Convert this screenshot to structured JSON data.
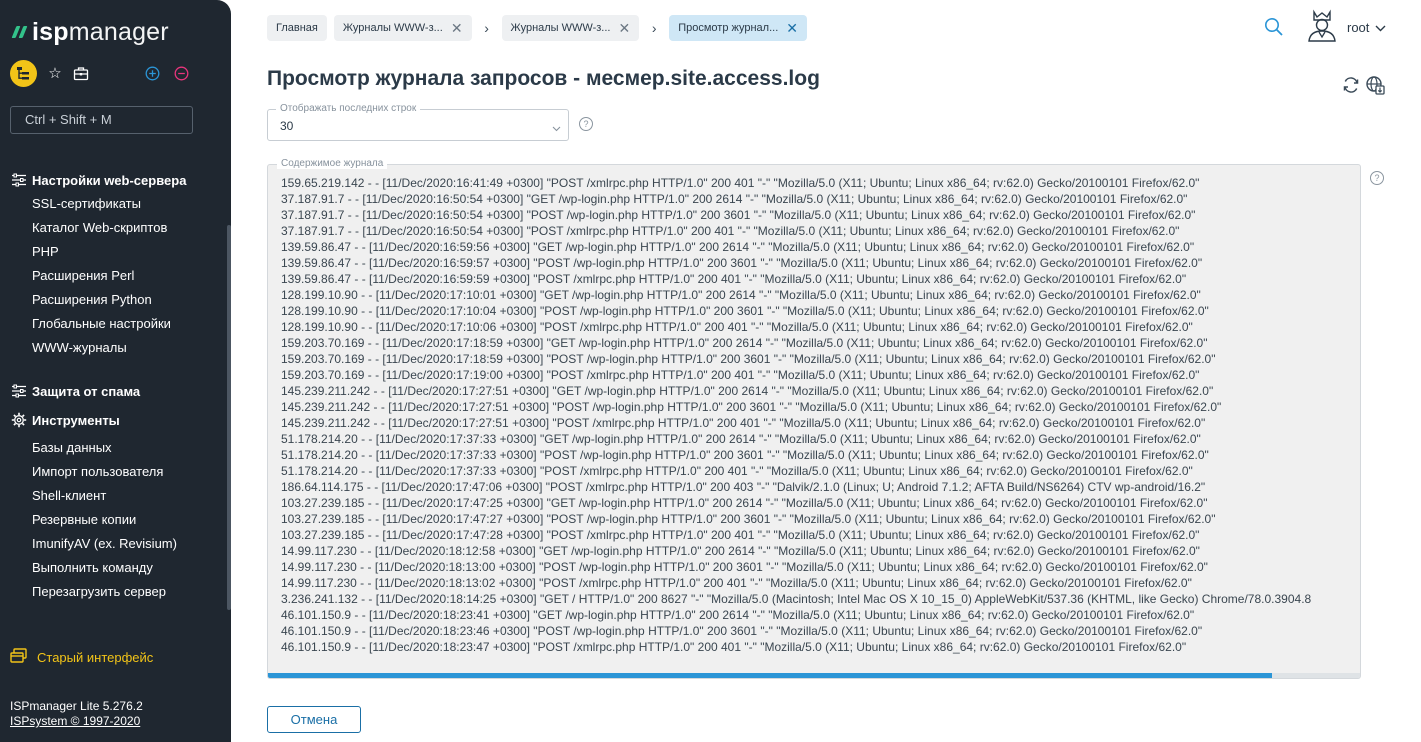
{
  "logo": {
    "part1": "isp",
    "part2": "manager"
  },
  "sidebar": {
    "search_placeholder": "Ctrl + Shift + M",
    "groups": [
      {
        "label": "Настройки web-сервера",
        "icon": "sliders-icon",
        "items": [
          "SSL-сертификаты",
          "Каталог Web-скриптов",
          "PHP",
          "Расширения Perl",
          "Расширения Python",
          "Глобальные настройки",
          "WWW-журналы"
        ]
      },
      {
        "label": "Защита от спама",
        "icon": "sliders-icon",
        "items": []
      },
      {
        "label": "Инструменты",
        "icon": "gear-icon",
        "items": [
          "Базы данных",
          "Импорт пользователя",
          "Shell-клиент",
          "Резервные копии",
          "ImunifyAV (ex. Revisium)",
          "Выполнить команду",
          "Перезагрузить сервер"
        ]
      }
    ],
    "old_interface": "Старый интерфейс",
    "version": "ISPmanager Lite 5.276.2",
    "copyright": "ISPsystem © 1997-2020"
  },
  "breadcrumbs": [
    "Главная",
    "Журналы WWW-з...",
    "Журналы WWW-з...",
    "Просмотр журнал..."
  ],
  "user": {
    "name": "root"
  },
  "page": {
    "title": "Просмотр журнала запросов - месмеp.site.access.log",
    "lines_field": {
      "label": "Отображать последних строк",
      "value": "30"
    },
    "log_label": "Содержимое журнала",
    "help_symbol": "?",
    "cancel": "Отмена",
    "log_lines": [
      "159.65.219.142 - - [11/Dec/2020:16:41:49 +0300] \"POST /xmlrpc.php HTTP/1.0\" 200 401 \"-\" \"Mozilla/5.0 (X11; Ubuntu; Linux x86_64; rv:62.0) Gecko/20100101 Firefox/62.0\"",
      "37.187.91.7 - - [11/Dec/2020:16:50:54 +0300] \"GET /wp-login.php HTTP/1.0\" 200 2614 \"-\" \"Mozilla/5.0 (X11; Ubuntu; Linux x86_64; rv:62.0) Gecko/20100101 Firefox/62.0\"",
      "37.187.91.7 - - [11/Dec/2020:16:50:54 +0300] \"POST /wp-login.php HTTP/1.0\" 200 3601 \"-\" \"Mozilla/5.0 (X11; Ubuntu; Linux x86_64; rv:62.0) Gecko/20100101 Firefox/62.0\"",
      "37.187.91.7 - - [11/Dec/2020:16:50:54 +0300] \"POST /xmlrpc.php HTTP/1.0\" 200 401 \"-\" \"Mozilla/5.0 (X11; Ubuntu; Linux x86_64; rv:62.0) Gecko/20100101 Firefox/62.0\"",
      "139.59.86.47 - - [11/Dec/2020:16:59:56 +0300] \"GET /wp-login.php HTTP/1.0\" 200 2614 \"-\" \"Mozilla/5.0 (X11; Ubuntu; Linux x86_64; rv:62.0) Gecko/20100101 Firefox/62.0\"",
      "139.59.86.47 - - [11/Dec/2020:16:59:57 +0300] \"POST /wp-login.php HTTP/1.0\" 200 3601 \"-\" \"Mozilla/5.0 (X11; Ubuntu; Linux x86_64; rv:62.0) Gecko/20100101 Firefox/62.0\"",
      "139.59.86.47 - - [11/Dec/2020:16:59:59 +0300] \"POST /xmlrpc.php HTTP/1.0\" 200 401 \"-\" \"Mozilla/5.0 (X11; Ubuntu; Linux x86_64; rv:62.0) Gecko/20100101 Firefox/62.0\"",
      "128.199.10.90 - - [11/Dec/2020:17:10:01 +0300] \"GET /wp-login.php HTTP/1.0\" 200 2614 \"-\" \"Mozilla/5.0 (X11; Ubuntu; Linux x86_64; rv:62.0) Gecko/20100101 Firefox/62.0\"",
      "128.199.10.90 - - [11/Dec/2020:17:10:04 +0300] \"POST /wp-login.php HTTP/1.0\" 200 3601 \"-\" \"Mozilla/5.0 (X11; Ubuntu; Linux x86_64; rv:62.0) Gecko/20100101 Firefox/62.0\"",
      "128.199.10.90 - - [11/Dec/2020:17:10:06 +0300] \"POST /xmlrpc.php HTTP/1.0\" 200 401 \"-\" \"Mozilla/5.0 (X11; Ubuntu; Linux x86_64; rv:62.0) Gecko/20100101 Firefox/62.0\"",
      "159.203.70.169 - - [11/Dec/2020:17:18:59 +0300] \"GET /wp-login.php HTTP/1.0\" 200 2614 \"-\" \"Mozilla/5.0 (X11; Ubuntu; Linux x86_64; rv:62.0) Gecko/20100101 Firefox/62.0\"",
      "159.203.70.169 - - [11/Dec/2020:17:18:59 +0300] \"POST /wp-login.php HTTP/1.0\" 200 3601 \"-\" \"Mozilla/5.0 (X11; Ubuntu; Linux x86_64; rv:62.0) Gecko/20100101 Firefox/62.0\"",
      "159.203.70.169 - - [11/Dec/2020:17:19:00 +0300] \"POST /xmlrpc.php HTTP/1.0\" 200 401 \"-\" \"Mozilla/5.0 (X11; Ubuntu; Linux x86_64; rv:62.0) Gecko/20100101 Firefox/62.0\"",
      "145.239.211.242 - - [11/Dec/2020:17:27:51 +0300] \"GET /wp-login.php HTTP/1.0\" 200 2614 \"-\" \"Mozilla/5.0 (X11; Ubuntu; Linux x86_64; rv:62.0) Gecko/20100101 Firefox/62.0\"",
      "145.239.211.242 - - [11/Dec/2020:17:27:51 +0300] \"POST /wp-login.php HTTP/1.0\" 200 3601 \"-\" \"Mozilla/5.0 (X11; Ubuntu; Linux x86_64; rv:62.0) Gecko/20100101 Firefox/62.0\"",
      "145.239.211.242 - - [11/Dec/2020:17:27:51 +0300] \"POST /xmlrpc.php HTTP/1.0\" 200 401 \"-\" \"Mozilla/5.0 (X11; Ubuntu; Linux x86_64; rv:62.0) Gecko/20100101 Firefox/62.0\"",
      "51.178.214.20 - - [11/Dec/2020:17:37:33 +0300] \"GET /wp-login.php HTTP/1.0\" 200 2614 \"-\" \"Mozilla/5.0 (X11; Ubuntu; Linux x86_64; rv:62.0) Gecko/20100101 Firefox/62.0\"",
      "51.178.214.20 - - [11/Dec/2020:17:37:33 +0300] \"POST /wp-login.php HTTP/1.0\" 200 3601 \"-\" \"Mozilla/5.0 (X11; Ubuntu; Linux x86_64; rv:62.0) Gecko/20100101 Firefox/62.0\"",
      "51.178.214.20 - - [11/Dec/2020:17:37:33 +0300] \"POST /xmlrpc.php HTTP/1.0\" 200 401 \"-\" \"Mozilla/5.0 (X11; Ubuntu; Linux x86_64; rv:62.0) Gecko/20100101 Firefox/62.0\"",
      "186.64.114.175 - - [11/Dec/2020:17:47:06 +0300] \"POST /xmlrpc.php HTTP/1.0\" 200 403 \"-\" \"Dalvik/2.1.0 (Linux; U; Android 7.1.2; AFTA Build/NS6264) CTV wp-android/16.2\"",
      "103.27.239.185 - - [11/Dec/2020:17:47:25 +0300] \"GET /wp-login.php HTTP/1.0\" 200 2614 \"-\" \"Mozilla/5.0 (X11; Ubuntu; Linux x86_64; rv:62.0) Gecko/20100101 Firefox/62.0\"",
      "103.27.239.185 - - [11/Dec/2020:17:47:27 +0300] \"POST /wp-login.php HTTP/1.0\" 200 3601 \"-\" \"Mozilla/5.0 (X11; Ubuntu; Linux x86_64; rv:62.0) Gecko/20100101 Firefox/62.0\"",
      "103.27.239.185 - - [11/Dec/2020:17:47:28 +0300] \"POST /xmlrpc.php HTTP/1.0\" 200 401 \"-\" \"Mozilla/5.0 (X11; Ubuntu; Linux x86_64; rv:62.0) Gecko/20100101 Firefox/62.0\"",
      "14.99.117.230 - - [11/Dec/2020:18:12:58 +0300] \"GET /wp-login.php HTTP/1.0\" 200 2614 \"-\" \"Mozilla/5.0 (X11; Ubuntu; Linux x86_64; rv:62.0) Gecko/20100101 Firefox/62.0\"",
      "14.99.117.230 - - [11/Dec/2020:18:13:00 +0300] \"POST /wp-login.php HTTP/1.0\" 200 3601 \"-\" \"Mozilla/5.0 (X11; Ubuntu; Linux x86_64; rv:62.0) Gecko/20100101 Firefox/62.0\"",
      "14.99.117.230 - - [11/Dec/2020:18:13:02 +0300] \"POST /xmlrpc.php HTTP/1.0\" 200 401 \"-\" \"Mozilla/5.0 (X11; Ubuntu; Linux x86_64; rv:62.0) Gecko/20100101 Firefox/62.0\"",
      "3.236.241.132 - - [11/Dec/2020:18:14:25 +0300] \"GET / HTTP/1.0\" 200 8627 \"-\" \"Mozilla/5.0 (Macintosh; Intel Mac OS X 10_15_0) AppleWebKit/537.36 (KHTML, like Gecko) Chrome/78.0.3904.8",
      "46.101.150.9 - - [11/Dec/2020:18:23:41 +0300] \"GET /wp-login.php HTTP/1.0\" 200 2614 \"-\" \"Mozilla/5.0 (X11; Ubuntu; Linux x86_64; rv:62.0) Gecko/20100101 Firefox/62.0\"",
      "46.101.150.9 - - [11/Dec/2020:18:23:46 +0300] \"POST /wp-login.php HTTP/1.0\" 200 3601 \"-\" \"Mozilla/5.0 (X11; Ubuntu; Linux x86_64; rv:62.0) Gecko/20100101 Firefox/62.0\"",
      "46.101.150.9 - - [11/Dec/2020:18:23:47 +0300] \"POST /xmlrpc.php HTTP/1.0\" 200 401 \"-\" \"Mozilla/5.0 (X11; Ubuntu; Linux x86_64; rv:62.0) Gecko/20100101 Firefox/62.0\""
    ]
  },
  "colors": {
    "sidebar_bg": "#1f2730",
    "accent": "#1a6fa6",
    "brand_green": "#33c28a",
    "highlight_yellow": "#f2c418"
  }
}
